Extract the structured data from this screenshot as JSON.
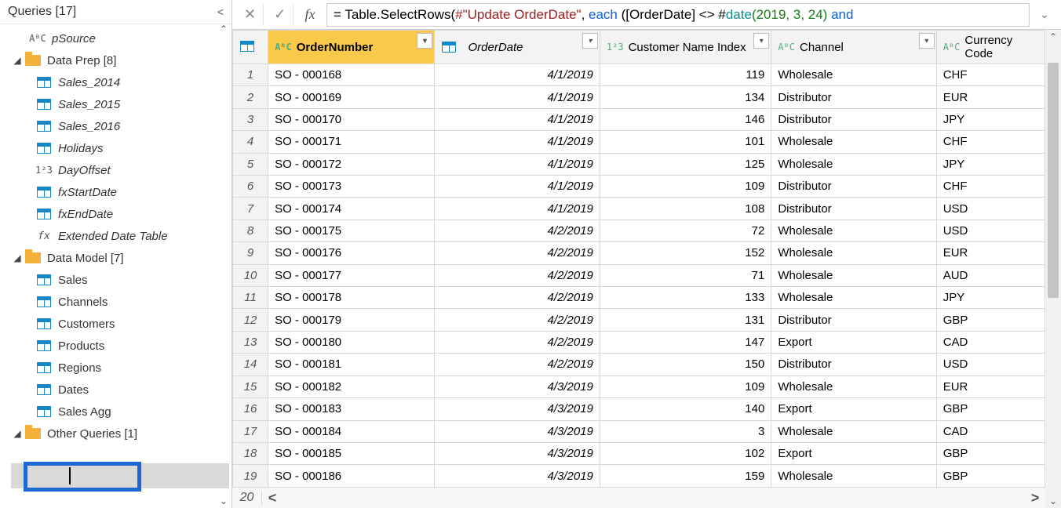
{
  "sidebar": {
    "title": "Queries [17]",
    "psource": "pSource",
    "groups": [
      {
        "label": "Data Prep [8]",
        "items": [
          {
            "label": "Sales_2014",
            "icon": "table",
            "italic": true
          },
          {
            "label": "Sales_2015",
            "icon": "table",
            "italic": true
          },
          {
            "label": "Sales_2016",
            "icon": "table",
            "italic": true
          },
          {
            "label": "Holidays",
            "icon": "table",
            "italic": true
          },
          {
            "label": "DayOffset",
            "icon": "123",
            "italic": true
          },
          {
            "label": "fxStartDate",
            "icon": "table",
            "italic": true
          },
          {
            "label": "fxEndDate",
            "icon": "table",
            "italic": true
          },
          {
            "label": "Extended Date Table",
            "icon": "fx",
            "italic": true
          }
        ]
      },
      {
        "label": "Data Model [7]",
        "items": [
          {
            "label": "Sales",
            "icon": "table"
          },
          {
            "label": "Channels",
            "icon": "table"
          },
          {
            "label": "Customers",
            "icon": "table"
          },
          {
            "label": "Products",
            "icon": "table"
          },
          {
            "label": "Regions",
            "icon": "table"
          },
          {
            "label": "Dates",
            "icon": "table"
          },
          {
            "label": "Sales Agg",
            "icon": "table",
            "selected": true
          }
        ]
      },
      {
        "label": "Other Queries [1]"
      }
    ]
  },
  "formula": {
    "prefix": "= Table.SelectRows(",
    "arg1": "#\"Update OrderDate\"",
    "kw_each": "each",
    "mid": " ([OrderDate] <> #",
    "fn_date": "date",
    "nums": "(2019, 3, 24)",
    "tail": " and"
  },
  "columns": {
    "order": "OrderNumber",
    "date": "OrderDate",
    "idx": "Customer Name Index",
    "chan": "Channel",
    "curr": "Currency Code"
  },
  "coltypes": {
    "order": "AᴮC",
    "date": "📅",
    "idx": "1²3",
    "chan": "AᴮC",
    "curr": "AᴮC"
  },
  "rows": [
    {
      "n": 1,
      "order": "SO - 000168",
      "date": "4/1/2019",
      "idx": 119,
      "chan": "Wholesale",
      "curr": "CHF"
    },
    {
      "n": 2,
      "order": "SO - 000169",
      "date": "4/1/2019",
      "idx": 134,
      "chan": "Distributor",
      "curr": "EUR"
    },
    {
      "n": 3,
      "order": "SO - 000170",
      "date": "4/1/2019",
      "idx": 146,
      "chan": "Distributor",
      "curr": "JPY"
    },
    {
      "n": 4,
      "order": "SO - 000171",
      "date": "4/1/2019",
      "idx": 101,
      "chan": "Wholesale",
      "curr": "CHF"
    },
    {
      "n": 5,
      "order": "SO - 000172",
      "date": "4/1/2019",
      "idx": 125,
      "chan": "Wholesale",
      "curr": "JPY"
    },
    {
      "n": 6,
      "order": "SO - 000173",
      "date": "4/1/2019",
      "idx": 109,
      "chan": "Distributor",
      "curr": "CHF"
    },
    {
      "n": 7,
      "order": "SO - 000174",
      "date": "4/1/2019",
      "idx": 108,
      "chan": "Distributor",
      "curr": "USD"
    },
    {
      "n": 8,
      "order": "SO - 000175",
      "date": "4/2/2019",
      "idx": 72,
      "chan": "Wholesale",
      "curr": "USD"
    },
    {
      "n": 9,
      "order": "SO - 000176",
      "date": "4/2/2019",
      "idx": 152,
      "chan": "Wholesale",
      "curr": "EUR"
    },
    {
      "n": 10,
      "order": "SO - 000177",
      "date": "4/2/2019",
      "idx": 71,
      "chan": "Wholesale",
      "curr": "AUD"
    },
    {
      "n": 11,
      "order": "SO - 000178",
      "date": "4/2/2019",
      "idx": 133,
      "chan": "Wholesale",
      "curr": "JPY"
    },
    {
      "n": 12,
      "order": "SO - 000179",
      "date": "4/2/2019",
      "idx": 131,
      "chan": "Distributor",
      "curr": "GBP"
    },
    {
      "n": 13,
      "order": "SO - 000180",
      "date": "4/2/2019",
      "idx": 147,
      "chan": "Export",
      "curr": "CAD"
    },
    {
      "n": 14,
      "order": "SO - 000181",
      "date": "4/2/2019",
      "idx": 150,
      "chan": "Distributor",
      "curr": "USD"
    },
    {
      "n": 15,
      "order": "SO - 000182",
      "date": "4/3/2019",
      "idx": 109,
      "chan": "Wholesale",
      "curr": "EUR"
    },
    {
      "n": 16,
      "order": "SO - 000183",
      "date": "4/3/2019",
      "idx": 140,
      "chan": "Export",
      "curr": "GBP"
    },
    {
      "n": 17,
      "order": "SO - 000184",
      "date": "4/3/2019",
      "idx": 3,
      "chan": "Wholesale",
      "curr": "CAD"
    },
    {
      "n": 18,
      "order": "SO - 000185",
      "date": "4/3/2019",
      "idx": 102,
      "chan": "Export",
      "curr": "GBP"
    },
    {
      "n": 19,
      "order": "SO - 000186",
      "date": "4/3/2019",
      "idx": 159,
      "chan": "Wholesale",
      "curr": "GBP"
    }
  ],
  "lastRowNum": 20
}
